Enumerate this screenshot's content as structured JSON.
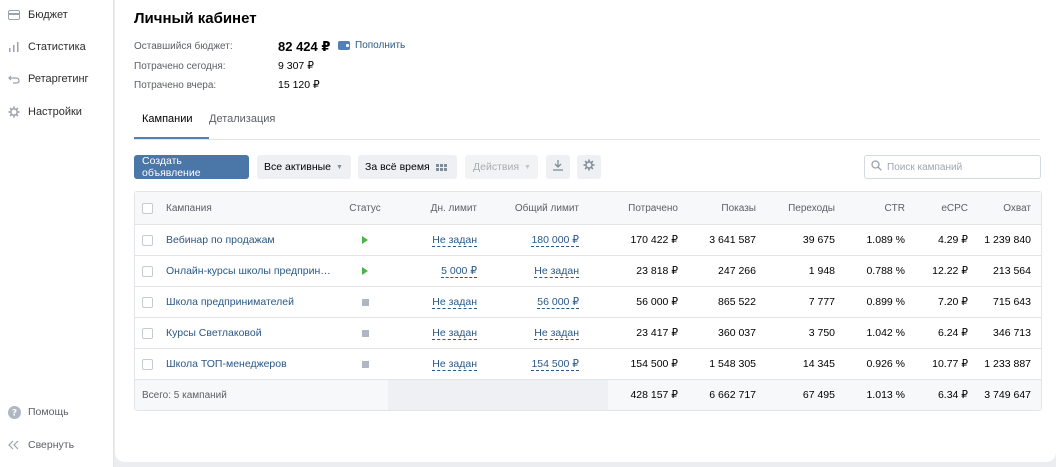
{
  "sidebar": {
    "items": [
      {
        "label": "Бюджет",
        "icon": "wallet-icon"
      },
      {
        "label": "Статистика",
        "icon": "bar-chart-icon"
      },
      {
        "label": "Ретаргетинг",
        "icon": "retarget-icon"
      },
      {
        "label": "Настройки",
        "icon": "gear-icon"
      }
    ],
    "help_label": "Помощь",
    "collapse_label": "Свернуть"
  },
  "header": {
    "title": "Личный кабинет",
    "budget_label": "Оставшийся бюджет:",
    "budget_value": "82 424 ₽",
    "topup_label": "Пополнить",
    "spent_today_label": "Потрачено сегодня:",
    "spent_today_value": "9 307 ₽",
    "spent_yesterday_label": "Потрачено вчера:",
    "spent_yesterday_value": "15 120 ₽"
  },
  "tabs": [
    {
      "label": "Кампании",
      "active": true
    },
    {
      "label": "Детализация",
      "active": false
    }
  ],
  "toolbar": {
    "create_label": "Создать объявление",
    "filter_label": "Все активные",
    "period_label": "За всё время",
    "actions_label": "Действия",
    "search_placeholder": "Поиск кампаний"
  },
  "table": {
    "headers": {
      "campaign": "Кампания",
      "status": "Статус",
      "daily_limit": "Дн. лимит",
      "total_limit": "Общий лимит",
      "spent": "Потрачено",
      "impressions": "Показы",
      "clicks": "Переходы",
      "ctr": "CTR",
      "ecpc": "eCPC",
      "reach": "Охват"
    },
    "rows": [
      {
        "name": "Вебинар по продажам",
        "status": "running",
        "daily_limit": "Не задан",
        "total_limit": "180 000 ₽",
        "spent": "170 422 ₽",
        "impressions": "3 641 587",
        "clicks": "39 675",
        "ctr": "1.089 %",
        "ecpc": "4.29 ₽",
        "reach": "1 239 840"
      },
      {
        "name": "Онлайн-курсы школы предприн…",
        "status": "running",
        "daily_limit": "5 000 ₽",
        "total_limit": "Не задан",
        "spent": "23 818 ₽",
        "impressions": "247 266",
        "clicks": "1 948",
        "ctr": "0.788 %",
        "ecpc": "12.22 ₽",
        "reach": "213 564"
      },
      {
        "name": "Школа предпринимателей",
        "status": "stopped",
        "daily_limit": "Не задан",
        "total_limit": "56 000 ₽",
        "spent": "56 000 ₽",
        "impressions": "865 522",
        "clicks": "7 777",
        "ctr": "0.899 %",
        "ecpc": "7.20 ₽",
        "reach": "715 643"
      },
      {
        "name": "Курсы Светлаковой",
        "status": "stopped",
        "daily_limit": "Не задан",
        "total_limit": "Не задан",
        "spent": "23 417 ₽",
        "impressions": "360 037",
        "clicks": "3 750",
        "ctr": "1.042 %",
        "ecpc": "6.24 ₽",
        "reach": "346 713"
      },
      {
        "name": "Школа ТОП-менеджеров",
        "status": "stopped",
        "daily_limit": "Не задан",
        "total_limit": "154 500 ₽",
        "spent": "154 500 ₽",
        "impressions": "1 548 305",
        "clicks": "14 345",
        "ctr": "0.926 %",
        "ecpc": "10.77 ₽",
        "reach": "1 233 887"
      }
    ],
    "footer": {
      "label": "Всего: 5 кампаний",
      "spent": "428 157 ₽",
      "impressions": "6 662 717",
      "clicks": "67 495",
      "ctr": "1.013 %",
      "ecpc": "6.34 ₽",
      "reach": "3 749 647"
    }
  },
  "colors": {
    "accent": "#4a76a8",
    "link": "#2a5885",
    "running": "#4bb34b",
    "stopped": "#aeb7c2"
  }
}
